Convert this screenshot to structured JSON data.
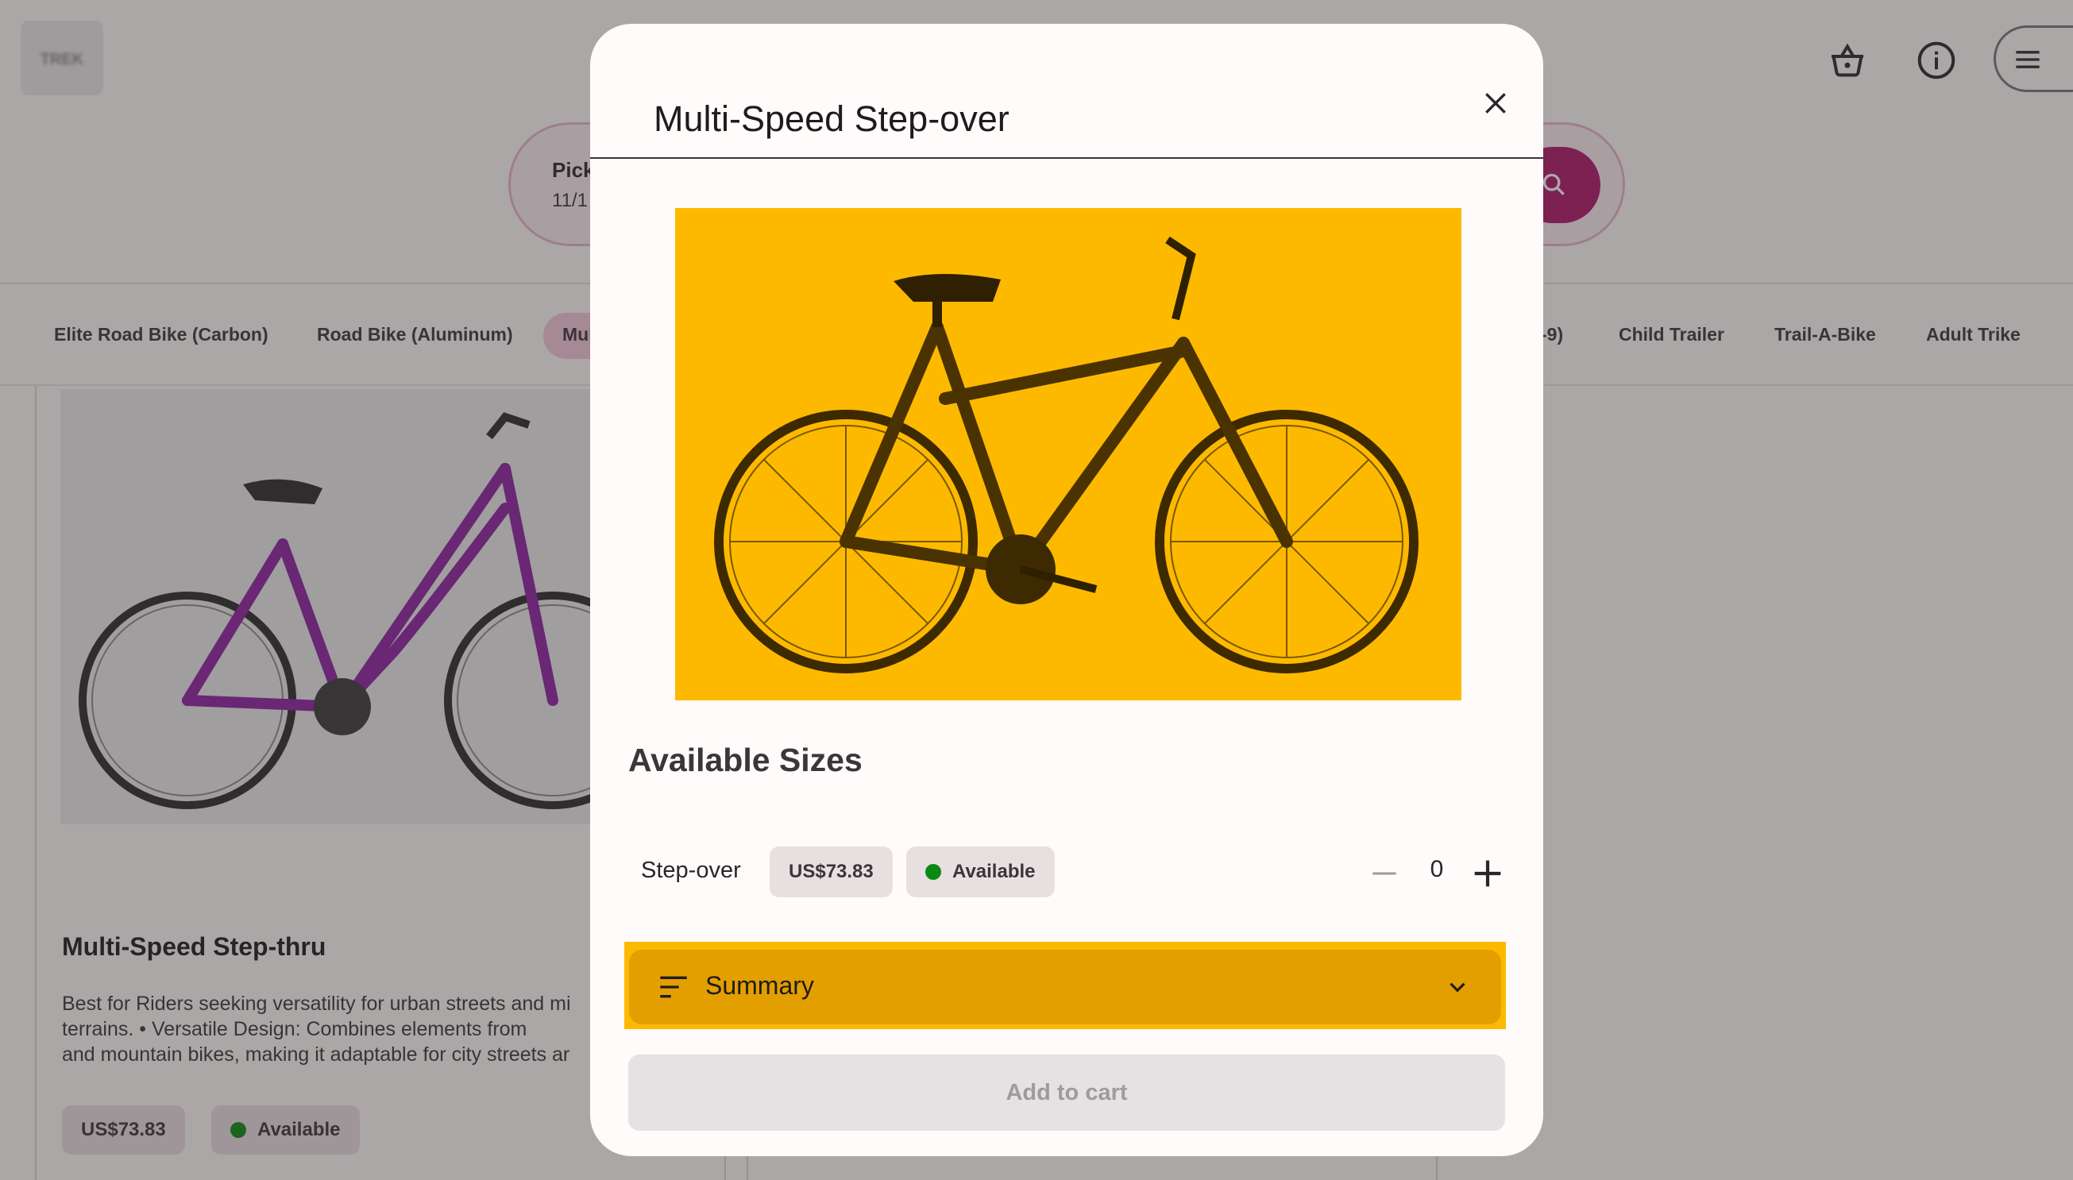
{
  "header": {
    "logo_text": "TREK",
    "cart_icon": "basket-icon",
    "info_icon": "info-icon",
    "menu_icon": "hamburger-menu-icon"
  },
  "search": {
    "pick_label": "Pick",
    "pick_date": "11/1",
    "search_icon": "search-icon"
  },
  "categories": {
    "items": [
      "Elite Road Bike (Carbon)",
      "Road Bike (Aluminum)",
      "Mul",
      "-9)",
      "Child Trailer",
      "Trail-A-Bike",
      "Adult Trike"
    ]
  },
  "background_card": {
    "title": "Multi-Speed Step-thru",
    "description": "Best for Riders seeking versatility for urban streets and mi\nterrains. •         Versatile Design: Combines elements from\nand mountain bikes, making it adaptable for city streets ar",
    "price": "US$73.83",
    "availability": "Available"
  },
  "dialog": {
    "title": "Multi-Speed Step-over",
    "close_icon": "close-icon",
    "sizes_heading": "Available Sizes",
    "size": {
      "name": "Step-over",
      "price": "US$73.83",
      "availability": "Available",
      "quantity": "0"
    },
    "summary_label": "Summary",
    "add_to_cart_label": "Add to cart"
  },
  "colors": {
    "brand": "#b0166a",
    "image_bg": "#fdb900",
    "summary_bg": "#e39f00",
    "available_dot": "#0a8a12"
  }
}
